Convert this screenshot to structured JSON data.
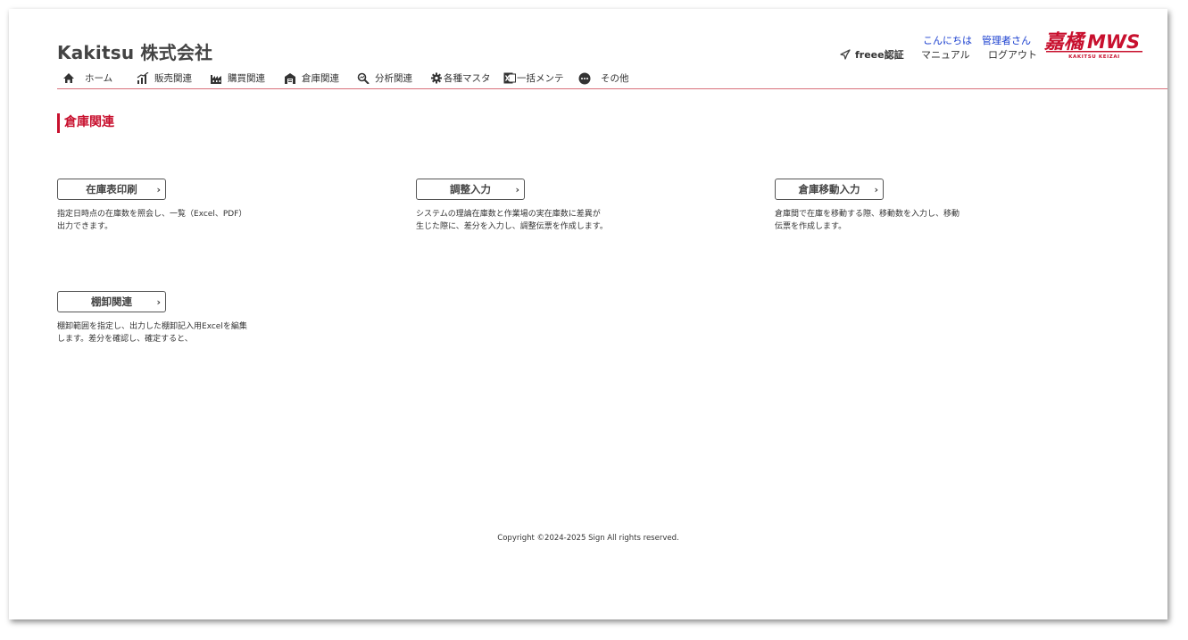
{
  "header": {
    "company_name": "Kakitsu 株式会社",
    "greeting": "こんにちは",
    "user_name": "管理者さん",
    "freee_label": "freee認証",
    "manual_label": "マニュアル",
    "logout_label": "ログアウト",
    "logo_main": "嘉橘 MWS",
    "logo_sub": "KAKITSU KEIZAI"
  },
  "nav": {
    "items": [
      {
        "label": "ホーム",
        "icon": "home-icon"
      },
      {
        "label": "販売関連",
        "icon": "sales-chart-icon"
      },
      {
        "label": "購買関連",
        "icon": "factory-icon"
      },
      {
        "label": "倉庫関連",
        "icon": "warehouse-icon"
      },
      {
        "label": "分析関連",
        "icon": "analysis-icon"
      },
      {
        "label": "各種マスタ",
        "icon": "gear-icon"
      },
      {
        "label": "一括メンテ",
        "icon": "excel-icon"
      },
      {
        "label": "その他",
        "icon": "more-icon"
      }
    ]
  },
  "main": {
    "section_title": "倉庫関連",
    "cards": [
      {
        "label": "在庫表印刷",
        "description": "指定日時点の在庫数を照会し、一覧（Excel、PDF）出力できます。"
      },
      {
        "label": "調整入力",
        "description": "システムの理論在庫数と作業場の実在庫数に差異が生じた際に、差分を入力し、調整伝票を作成します。"
      },
      {
        "label": "倉庫移動入力",
        "description": "倉庫間で在庫を移動する際、移動数を入力し、移動伝票を作成します。"
      },
      {
        "label": "棚卸関連",
        "description": "棚卸範囲を指定し、出力した棚卸記入用Excelを編集します。差分を確認し、確定すると、"
      }
    ]
  },
  "footer": {
    "copyright": "Copyright ©2024-2025 Sign All rights reserved."
  },
  "colors": {
    "accent": "#c8102e",
    "link": "#1a3fcf"
  }
}
